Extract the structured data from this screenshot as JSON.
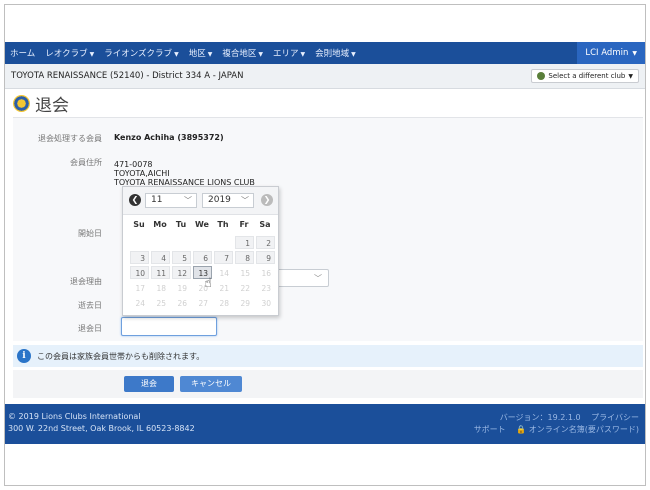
{
  "nav": {
    "items": [
      {
        "label": "ホーム",
        "dropdown": false
      },
      {
        "label": "レオクラブ",
        "dropdown": true
      },
      {
        "label": "ライオンズクラブ",
        "dropdown": true
      },
      {
        "label": "地区",
        "dropdown": true
      },
      {
        "label": "複合地区",
        "dropdown": true
      },
      {
        "label": "エリア",
        "dropdown": true
      },
      {
        "label": "会則地域",
        "dropdown": true
      }
    ],
    "user": "LCI Admin"
  },
  "club": {
    "name": "TOYOTA RENAISSANCE (52140) - District 334 A - JAPAN",
    "select_label": "Select a different club"
  },
  "page": {
    "title": "退会"
  },
  "form": {
    "member_label": "退会処理する会員",
    "member_value": "Kenzo Achiha (3895372)",
    "address_label": "会員住所",
    "address_lines": [
      "471-0078",
      "TOYOTA,AICHI",
      "TOYOTA RENAISSANCE LIONS CLUB"
    ],
    "start_label": "開始日",
    "reason_label": "退会理由",
    "death_label": "逝去日",
    "exit_label": "退会日"
  },
  "datepicker": {
    "month": "11",
    "year": "2019",
    "weekdays": [
      "Su",
      "Mo",
      "Tu",
      "We",
      "Th",
      "Fr",
      "Sa"
    ],
    "weeks": [
      [
        {
          "d": "",
          "s": "off"
        },
        {
          "d": "",
          "s": "off"
        },
        {
          "d": "",
          "s": "off"
        },
        {
          "d": "",
          "s": "off"
        },
        {
          "d": "",
          "s": "off"
        },
        {
          "d": "1",
          "s": "on"
        },
        {
          "d": "2",
          "s": "on"
        }
      ],
      [
        {
          "d": "3",
          "s": "on"
        },
        {
          "d": "4",
          "s": "on"
        },
        {
          "d": "5",
          "s": "on"
        },
        {
          "d": "6",
          "s": "on"
        },
        {
          "d": "7",
          "s": "on"
        },
        {
          "d": "8",
          "s": "on"
        },
        {
          "d": "9",
          "s": "on"
        }
      ],
      [
        {
          "d": "10",
          "s": "on"
        },
        {
          "d": "11",
          "s": "on"
        },
        {
          "d": "12",
          "s": "on"
        },
        {
          "d": "13",
          "s": "sel"
        },
        {
          "d": "14",
          "s": "off"
        },
        {
          "d": "15",
          "s": "off"
        },
        {
          "d": "16",
          "s": "off"
        }
      ],
      [
        {
          "d": "17",
          "s": "off"
        },
        {
          "d": "18",
          "s": "off"
        },
        {
          "d": "19",
          "s": "off"
        },
        {
          "d": "20",
          "s": "off"
        },
        {
          "d": "21",
          "s": "off"
        },
        {
          "d": "22",
          "s": "off"
        },
        {
          "d": "23",
          "s": "off"
        }
      ],
      [
        {
          "d": "24",
          "s": "off"
        },
        {
          "d": "25",
          "s": "off"
        },
        {
          "d": "26",
          "s": "off"
        },
        {
          "d": "27",
          "s": "off"
        },
        {
          "d": "28",
          "s": "off"
        },
        {
          "d": "29",
          "s": "off"
        },
        {
          "d": "30",
          "s": "off"
        }
      ]
    ]
  },
  "info": {
    "text": "この会員は家族会員世帯からも削除されます。"
  },
  "buttons": {
    "submit": "退会",
    "cancel": "キャンセル"
  },
  "footer": {
    "copyright": "© 2019 Lions Clubs International",
    "address": "300 W. 22nd Street, Oak Brook, IL 60523-8842",
    "version": "バージョン：19.2.1.0",
    "privacy": "プライバシー",
    "support": "サポート",
    "online": "オンライン名簿(要パスワード)"
  },
  "colors": {
    "brand": "#1b4f9a",
    "button": "#3d79c9",
    "info": "#e6f1fb"
  }
}
